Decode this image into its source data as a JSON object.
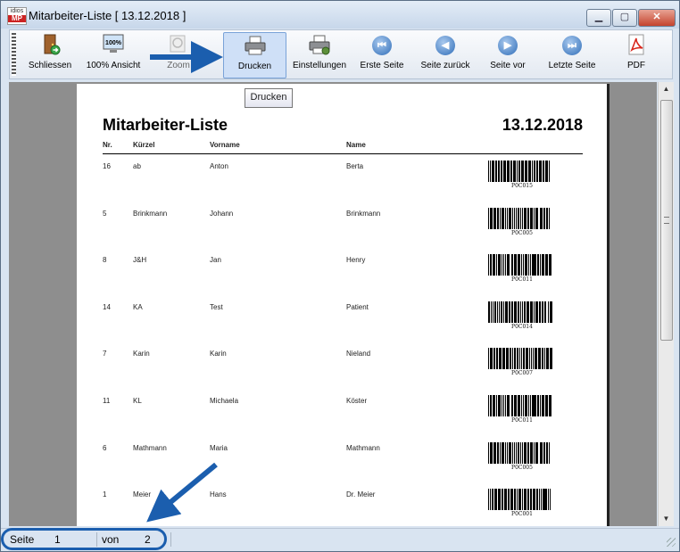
{
  "window": {
    "title": "Mitarbeiter-Liste [ 13.12.2018 ]",
    "app_icon_top": "idios",
    "app_icon_bottom": "MP",
    "min_label": "▁",
    "max_label": "▢",
    "close_label": "✕"
  },
  "toolbar": [
    {
      "label": "Schliessen",
      "icon": "door-exit-icon"
    },
    {
      "label": "100% Ansicht",
      "icon": "monitor-100-icon",
      "badge": "100%"
    },
    {
      "label": "Zoom",
      "icon": "zoom-icon"
    },
    {
      "label": "Drucken",
      "icon": "printer-icon"
    },
    {
      "label": "Einstellungen",
      "icon": "printer-settings-icon"
    },
    {
      "label": "Erste Seite",
      "icon": "first-page-icon",
      "glyph": "⏮"
    },
    {
      "label": "Seite zurück",
      "icon": "previous-page-icon",
      "glyph": "◀"
    },
    {
      "label": "Seite vor",
      "icon": "next-page-icon",
      "glyph": "▶"
    },
    {
      "label": "Letzte Seite",
      "icon": "last-page-icon",
      "glyph": "⏭"
    },
    {
      "label": "PDF",
      "icon": "pdf-icon"
    }
  ],
  "tooltip": "Drucken",
  "report": {
    "title": "Mitarbeiter-Liste",
    "date": "13.12.2018",
    "columns": [
      "Nr.",
      "Kürzel",
      "Vorname",
      "Name"
    ],
    "rows": [
      {
        "nr": "16",
        "kuerzel": "ab",
        "vorname": "Anton",
        "name": "Berta",
        "barcode": "P0C015"
      },
      {
        "nr": "5",
        "kuerzel": "Brinkmann",
        "vorname": "Johann",
        "name": "Brinkmann",
        "barcode": "P0C005"
      },
      {
        "nr": "8",
        "kuerzel": "J&H",
        "vorname": "Jan",
        "name": "Henry",
        "barcode": "P0C011"
      },
      {
        "nr": "14",
        "kuerzel": "KA",
        "vorname": "Test",
        "name": "Patient",
        "barcode": "P0C014"
      },
      {
        "nr": "7",
        "kuerzel": "Karin",
        "vorname": "Karin",
        "name": "Nieland",
        "barcode": "P0C007"
      },
      {
        "nr": "11",
        "kuerzel": "KL",
        "vorname": "Michaela",
        "name": "Köster",
        "barcode": "P0C011"
      },
      {
        "nr": "6",
        "kuerzel": "Mathmann",
        "vorname": "Maria",
        "name": "Mathmann",
        "barcode": "P0C005"
      },
      {
        "nr": "1",
        "kuerzel": "Meier",
        "vorname": "Hans",
        "name": "Dr. Meier",
        "barcode": "P0C001"
      }
    ]
  },
  "status": {
    "page_label": "Seite",
    "page_value": "1",
    "of_label": "von",
    "of_value": "2"
  },
  "scrollbar": {
    "up": "▲",
    "down": "▼"
  },
  "colors": {
    "annotation": "#1b5eae",
    "active_button": "#cfe0f7"
  }
}
